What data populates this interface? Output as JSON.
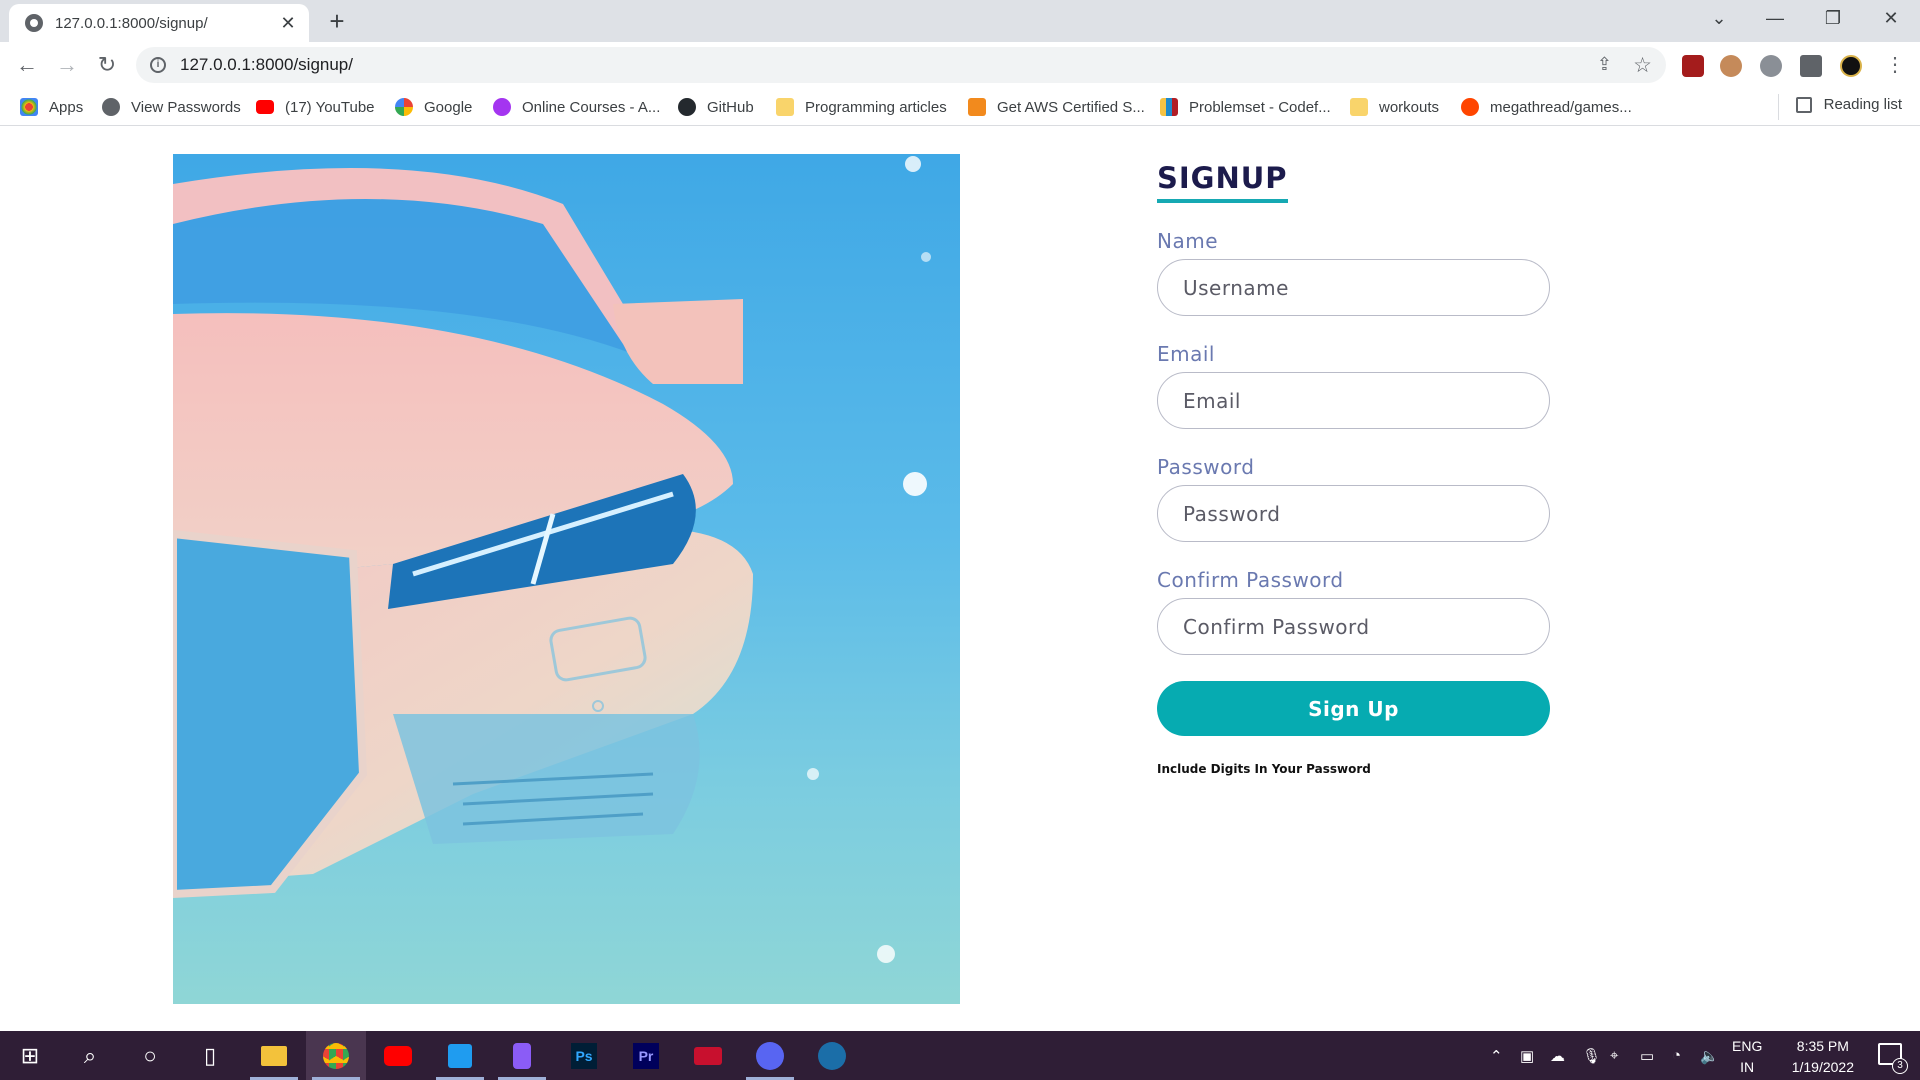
{
  "browser": {
    "tab_title": "127.0.0.1:8000/signup/",
    "url": "127.0.0.1:8000/signup/",
    "bookmarks": [
      {
        "label": "Apps",
        "icon": "apps-grid-icon",
        "color": "#ea4335"
      },
      {
        "label": "View Passwords",
        "icon": "globe-icon",
        "color": "#5f6368"
      },
      {
        "label": "(17) YouTube",
        "icon": "youtube-icon",
        "color": "#ff0000"
      },
      {
        "label": "Google",
        "icon": "google-icon",
        "color": "#4285f4"
      },
      {
        "label": "Online Courses - A...",
        "icon": "udemy-icon",
        "color": "#a435f0"
      },
      {
        "label": "GitHub",
        "icon": "github-icon",
        "color": "#24292e"
      },
      {
        "label": "Programming articles",
        "icon": "folder-icon",
        "color": "#f9d46b"
      },
      {
        "label": "Get AWS Certified S...",
        "icon": "aws-icon",
        "color": "#f28a1d"
      },
      {
        "label": "Problemset - Codef...",
        "icon": "codeforces-icon",
        "color": "#1f8acb"
      },
      {
        "label": "workouts",
        "icon": "folder-icon",
        "color": "#f9d46b"
      },
      {
        "label": "megathread/games...",
        "icon": "reddit-icon",
        "color": "#ff4500"
      }
    ],
    "reading_list": "Reading list"
  },
  "signup": {
    "heading": "SIGNUP",
    "name_label": "Name",
    "name_placeholder": "Username",
    "email_label": "Email",
    "email_placeholder": "Email",
    "password_label": "Password",
    "password_placeholder": "Password",
    "confirm_label": "Confirm Password",
    "confirm_placeholder": "Confirm Password",
    "submit_label": "Sign Up",
    "hint": "Include Digits In Your Password",
    "accent_color": "#06abb1",
    "heading_color": "#1c1b4c",
    "label_color": "#6a79b0"
  },
  "taskbar": {
    "language_line1": "ENG",
    "language_line2": "IN",
    "time": "8:35 PM",
    "date": "1/19/2022",
    "notification_count": "3"
  }
}
